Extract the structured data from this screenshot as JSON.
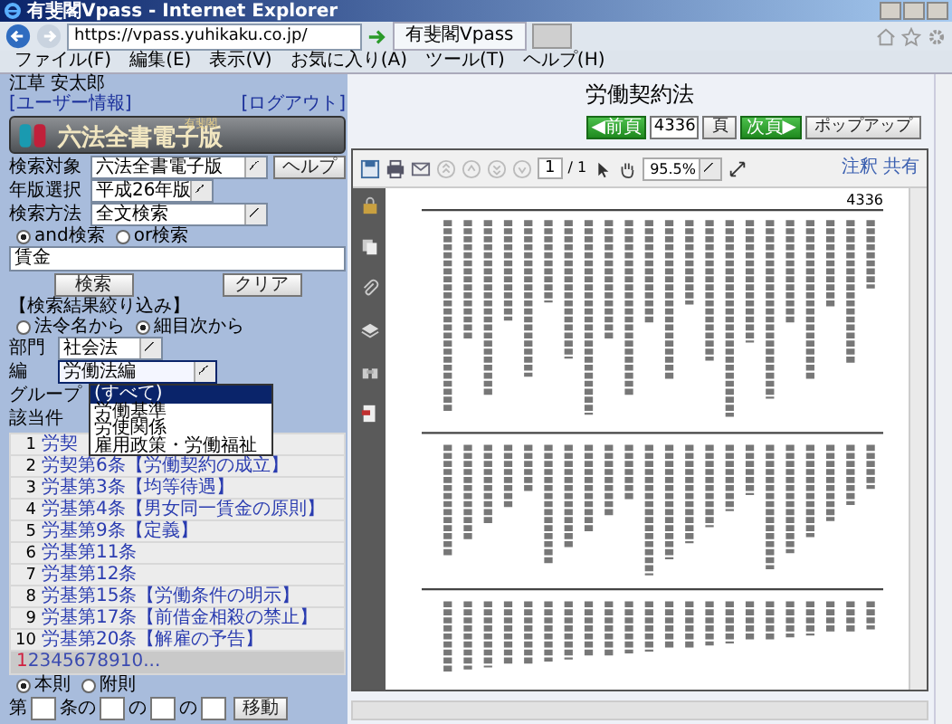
{
  "window": {
    "title": "有斐閣Vpass - Internet Explorer"
  },
  "address_bar": {
    "url": "https://vpass.yuhikaku.co.jp/"
  },
  "browser_tabs": [
    {
      "label": "有斐閣Vpass",
      "selected": true
    }
  ],
  "menu_bar": [
    "ファイル(F)",
    "編集(E)",
    "表示(V)",
    "お気に入り(A)",
    "ツール(T)",
    "ヘルプ(H)"
  ],
  "sidebar": {
    "user_name": "江草 安太郎",
    "user_info_link": "[ユーザー情報]",
    "logout_link": "[ログアウト]",
    "logo": {
      "publisher": "有斐閣",
      "title": "六法全書電子版"
    },
    "search_fields": [
      {
        "label": "検索対象",
        "value": "六法全書電子版"
      },
      {
        "label": "年版選択",
        "value": "平成26年版"
      },
      {
        "label": "検索方法",
        "value": "全文検索"
      }
    ],
    "help_button": "ヘルプ",
    "match_modes": [
      {
        "label": "and検索",
        "selected": true
      },
      {
        "label": "or検索",
        "selected": false
      }
    ],
    "query": "賃金",
    "search_button": "検索",
    "clear_button": "クリア",
    "filter_heading": "【検索結果絞り込み】",
    "filter_modes": [
      {
        "label": "法令名から",
        "selected": false
      },
      {
        "label": "細目次から",
        "selected": true
      }
    ],
    "filters": [
      {
        "label": "部門",
        "value": "社会法",
        "expanded": false
      },
      {
        "label": "編",
        "value": "労働法編",
        "expanded": true,
        "options": [
          {
            "label": "(すべて)",
            "selected": true
          },
          {
            "label": "労働基準",
            "selected": false
          },
          {
            "label": "労使関係",
            "selected": false
          },
          {
            "label": "雇用政策・労働福祉",
            "selected": false
          }
        ]
      }
    ],
    "group_label": "グループ",
    "count_label": "該当件",
    "results": [
      {
        "number": "1",
        "title": "労契"
      },
      {
        "number": "2",
        "title": "労契第6条【労働契約の成立】"
      },
      {
        "number": "3",
        "title": "労基第3条【均等待遇】"
      },
      {
        "number": "4",
        "title": "労基第4条【男女同一賃金の原則】"
      },
      {
        "number": "5",
        "title": "労基第9条【定義】"
      },
      {
        "number": "6",
        "title": "労基第11条"
      },
      {
        "number": "7",
        "title": "労基第12条"
      },
      {
        "number": "8",
        "title": "労基第15条【労働条件の明示】"
      },
      {
        "number": "9",
        "title": "労基第17条【前借金相殺の禁止】"
      },
      {
        "number": "10",
        "title": "労基第20条【解雇の予告】"
      }
    ],
    "pages": [
      {
        "label": "1",
        "selected": true
      },
      {
        "label": "2",
        "selected": false
      },
      {
        "label": "3",
        "selected": false
      },
      {
        "label": "4",
        "selected": false
      },
      {
        "label": "5",
        "selected": false
      },
      {
        "label": "6",
        "selected": false
      },
      {
        "label": "7",
        "selected": false
      },
      {
        "label": "8",
        "selected": false
      },
      {
        "label": "9",
        "selected": false
      },
      {
        "label": "10",
        "selected": false
      }
    ],
    "more_pages": "...",
    "provision_modes": [
      {
        "label": "本則",
        "selected": true
      },
      {
        "label": "附則",
        "selected": false
      }
    ],
    "jump_labels": [
      "第",
      "条の",
      "の",
      "の"
    ],
    "jump_button": "移動"
  },
  "document": {
    "title": "労働契約法",
    "prev_button": "◀前頁",
    "page_input": "4336",
    "page_unit": "頁",
    "next_button": "次頁▶",
    "popup_button": "ポップアップ",
    "pdf_viewer": {
      "page_field": "1",
      "page_total": "/ 1",
      "zoom": "95.5%",
      "annotate": "注釈",
      "share": "共有",
      "scan_page_number": "4336"
    }
  }
}
